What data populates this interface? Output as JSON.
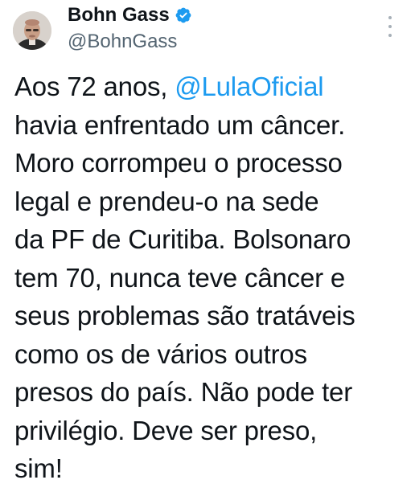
{
  "author": {
    "display_name": "Bohn Gass",
    "handle": "@BohnGass",
    "verified": true,
    "verified_color": "#1d9bf0",
    "avatar_icon": "profile-photo"
  },
  "menu": {
    "icon": "more-vertical-icon"
  },
  "tweet": {
    "lines": [
      {
        "before": "Aos 72 anos, ",
        "mention": "@LulaOficial",
        "after": ""
      },
      {
        "text": "havia enfrentado um câncer."
      },
      {
        "text": "Moro corrompeu o processo"
      },
      {
        "text": "legal e prendeu-o na sede"
      },
      {
        "text": "da PF de Curitiba. Bolsonaro"
      },
      {
        "text": "tem 70, nunca teve câncer e"
      },
      {
        "text": "seus problemas são tratáveis"
      },
      {
        "text": "como os de vários outros"
      },
      {
        "text": "presos do país. Não pode ter"
      },
      {
        "text": "privilégio. Deve ser preso,"
      },
      {
        "text": "sim!"
      }
    ]
  },
  "colors": {
    "text": "#0f1419",
    "secondary": "#536471",
    "link": "#1d9bf0",
    "background": "#ffffff"
  }
}
